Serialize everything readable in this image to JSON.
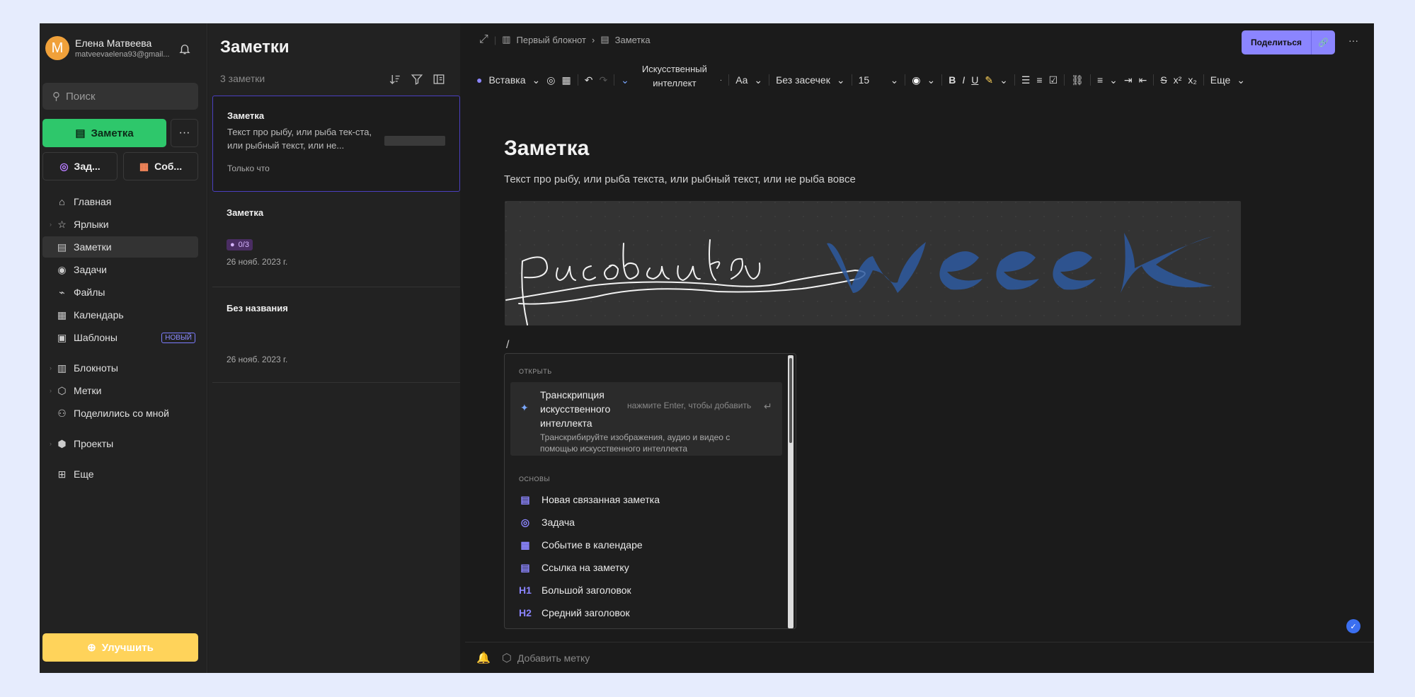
{
  "user": {
    "initial": "М",
    "name": "Елена Матвеева",
    "email": "matveevaelena93@gmail..."
  },
  "sidebar": {
    "search_placeholder": "Поиск",
    "new_note_label": "Заметка",
    "more_label": "···",
    "quick_task": "Зад...",
    "quick_event": "Соб...",
    "items": [
      {
        "label": "Главная",
        "icon": "home-icon"
      },
      {
        "label": "Ярлыки",
        "icon": "star-icon"
      },
      {
        "label": "Заметки",
        "icon": "note-icon"
      },
      {
        "label": "Задачи",
        "icon": "check-icon"
      },
      {
        "label": "Файлы",
        "icon": "paperclip-icon"
      },
      {
        "label": "Календарь",
        "icon": "calendar-icon"
      },
      {
        "label": "Шаблоны",
        "icon": "template-icon",
        "badge": "НОВЫЙ"
      },
      {
        "label": "Блокноты",
        "icon": "notebook-icon"
      },
      {
        "label": "Метки",
        "icon": "tag-icon"
      },
      {
        "label": "Поделились со мной",
        "icon": "users-icon"
      },
      {
        "label": "Проекты",
        "icon": "cube-icon"
      },
      {
        "label": "Еще",
        "icon": "grid-icon"
      }
    ],
    "upgrade_label": "Улучшить"
  },
  "notes_list": {
    "title": "Заметки",
    "count": "3 заметки",
    "cards": [
      {
        "title": "Заметка",
        "text": "Текст про рыбу, или рыба тек-ста, или рыбный текст, или не...",
        "time": "Только что"
      },
      {
        "title": "Заметка",
        "tasks": "0/3",
        "time": "26 нояб. 2023 г."
      },
      {
        "title": "Без названия",
        "time": "26 нояб. 2023 г."
      }
    ]
  },
  "editor": {
    "breadcrumb_notebook": "Первый блокнот",
    "breadcrumb_note": "Заметка",
    "share_label": "Поделиться",
    "toolbar": {
      "insert": "Вставка",
      "ai": "Искусственный интеллект",
      "font_size_icon": "Aa",
      "font_family": "Без засечек",
      "font_size": "15",
      "more": "Еще"
    },
    "doc_title": "Заметка",
    "doc_text": "Текст про рыбу, или рыба текста, или рыбный текст, или не рыба вовсе",
    "cursor_char": "/",
    "tag_placeholder": "Добавить метку"
  },
  "popup": {
    "section_open": "ОТКРЫТЬ",
    "ai_title": "Транскрипция искусственного интеллекта",
    "ai_hint": "нажмите Enter, чтобы добавить",
    "ai_desc": "Транскрибируйте изображения, аудио и видео с помощью искусственного интеллекта",
    "section_basic": "ОСНОВЫ",
    "items": [
      {
        "label": "Новая связанная заметка",
        "icon": "linked-note-icon"
      },
      {
        "label": "Задача",
        "icon": "task-icon"
      },
      {
        "label": "Событие в календаре",
        "icon": "calendar-event-icon"
      },
      {
        "label": "Ссылка на заметку",
        "icon": "note-link-icon"
      },
      {
        "label": "Большой заголовок",
        "icon": "h1-icon",
        "glyph": "H1"
      },
      {
        "label": "Средний заголовок",
        "icon": "h2-icon",
        "glyph": "H2"
      }
    ]
  },
  "colors": {
    "accent": "#8b85ff",
    "green": "#2ec76b",
    "upgrade": "#ffd35a"
  }
}
